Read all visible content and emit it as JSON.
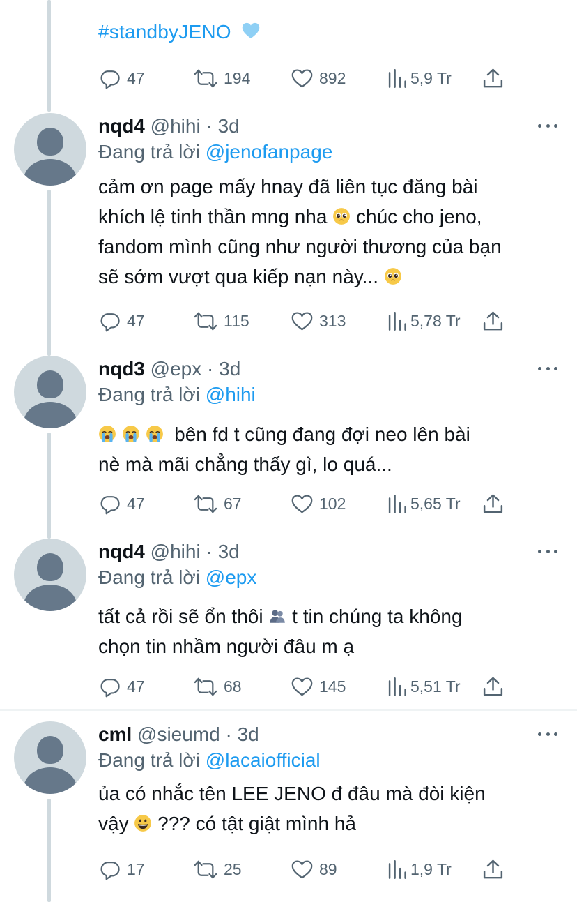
{
  "colors": {
    "accent": "#1d9bf0",
    "secondary_text": "#536471",
    "primary_text": "#0f1419",
    "thread_line": "#cfd9de"
  },
  "top_tweet": {
    "hashtag": "#standbyJENO",
    "emoji": "light-blue-heart",
    "actions": {
      "replies": "47",
      "retweets": "194",
      "likes": "892",
      "views": "5,9 Tr"
    }
  },
  "replies": [
    {
      "name": "nqd4",
      "handle": "@hihi",
      "separator": "·",
      "time": "3d",
      "replying_prefix": "Đang trả lời",
      "replying_to": "@jenofanpage",
      "lines": [
        {
          "text": "cảm ơn page mấy hnay đã liên tục đăng bài"
        },
        {
          "text": "khích lệ tinh thần mng nha",
          "emoji_after": "pleading-face",
          "text_after": "chúc cho jeno,"
        },
        {
          "text": "fandom mình cũng như người thương của bạn"
        },
        {
          "text": "sẽ sớm vượt qua kiếp nạn này...",
          "emoji_after": "pleading-face"
        }
      ],
      "actions": {
        "replies": "47",
        "retweets": "115",
        "likes": "313",
        "views": "5,78 Tr"
      }
    },
    {
      "name": "nqd3",
      "handle": "@epx",
      "separator": "·",
      "time": "3d",
      "replying_prefix": "Đang trả lời",
      "replying_to": "@hihi",
      "lines": [
        {
          "emoji_before": [
            "loudly-crying-face",
            "loudly-crying-face",
            "loudly-crying-face"
          ],
          "text": "bên fd t cũng đang đợi neo lên bài"
        },
        {
          "text": "nè mà mãi chẳng thấy gì, lo quá..."
        }
      ],
      "actions": {
        "replies": "47",
        "retweets": "67",
        "likes": "102",
        "views": "5,65 Tr"
      }
    },
    {
      "name": "nqd4",
      "handle": "@hihi",
      "separator": "·",
      "time": "3d",
      "replying_prefix": "Đang trả lời",
      "replying_to": "@epx",
      "lines": [
        {
          "text": "tất cả rồi sẽ ổn thôi",
          "emoji_after": "people-hugging",
          "text_after": "t tin chúng ta không"
        },
        {
          "text": "chọn tin nhầm người đâu m ạ"
        }
      ],
      "actions": {
        "replies": "47",
        "retweets": "68",
        "likes": "145",
        "views": "5,51 Tr"
      }
    },
    {
      "name": "cml",
      "handle": "@sieumd",
      "separator": "·",
      "time": "3d",
      "replying_prefix": "Đang trả lời",
      "replying_to": "@lacaiofficial",
      "lines": [
        {
          "text": "ủa có nhắc tên LEE JENO đ đâu mà đòi kiện"
        },
        {
          "text": "vậy",
          "emoji_after": "grinning-face",
          "text_after": "??? có tật giật mình hả"
        }
      ],
      "actions": {
        "replies": "17",
        "retweets": "25",
        "likes": "89",
        "views": "1,9 Tr"
      }
    }
  ],
  "icons": {
    "reply": "reply-icon",
    "retweet": "retweet-icon",
    "like": "heart-icon",
    "views": "views-icon",
    "share": "share-icon",
    "more": "more-icon"
  }
}
